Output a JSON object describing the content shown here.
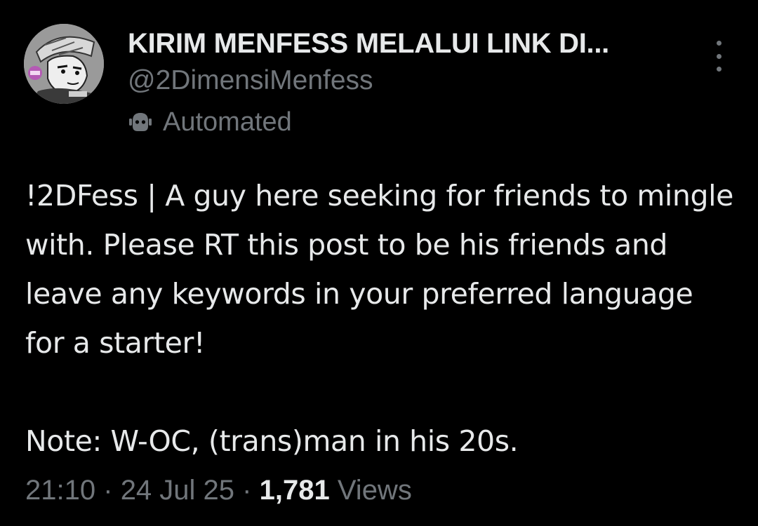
{
  "account": {
    "display_name": "KIRIM MENFESS MELALUI LINK DI...",
    "handle": "@2DimensiMenfess",
    "label": "Automated",
    "label_icon": "bot-icon",
    "avatar_icon": "profile-avatar"
  },
  "more_icon": "more-vertical-icon",
  "tweet": {
    "text": "!2DFess | A guy here seeking for friends to mingle with. Please RT this post to be his friends and leave any keywords in your preferred language for a starter!\n\nNote: W-OC, (trans)man in his 20s.",
    "time": "21:10",
    "separator": "·",
    "date": "24 Jul 25",
    "views_count": "1,781",
    "views_label": "Views"
  },
  "colors": {
    "background": "#000000",
    "primary_text": "#e7e9ea",
    "secondary_text": "#71767b"
  }
}
